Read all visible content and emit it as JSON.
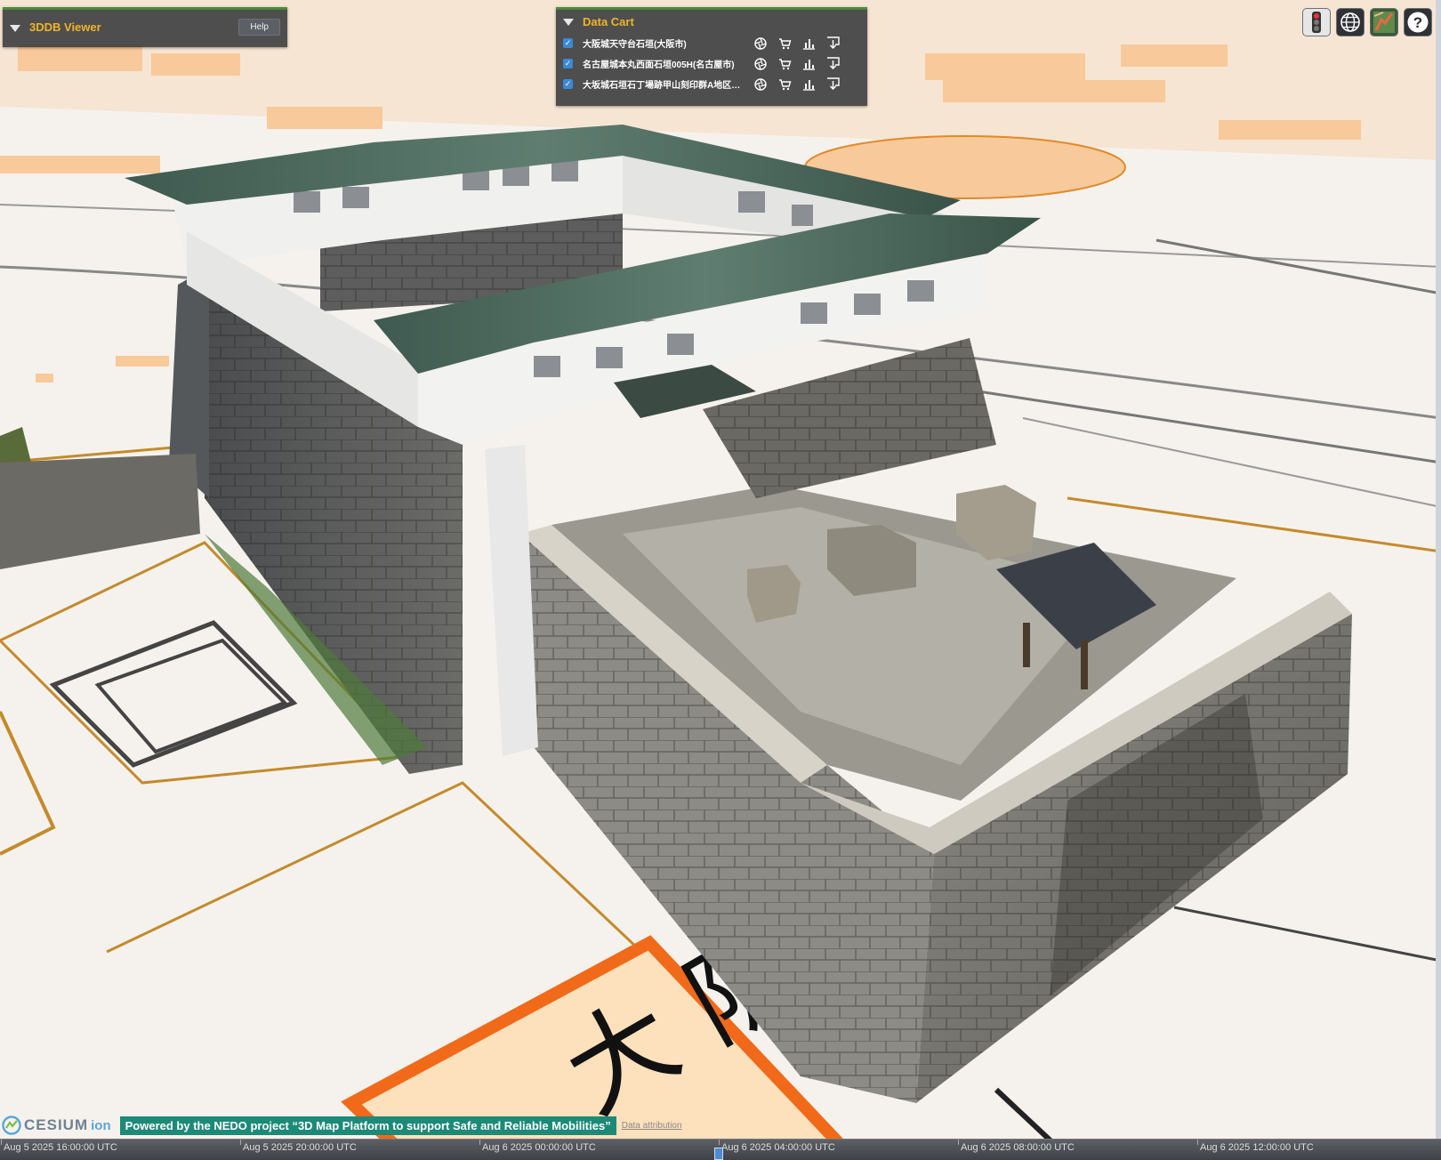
{
  "viewer_panel": {
    "title": "3DDB Viewer",
    "help_label": "Help"
  },
  "data_cart": {
    "title": "Data Cart",
    "items": [
      {
        "checked": true,
        "label": "大阪城天守台石垣(大阪市)"
      },
      {
        "checked": true,
        "label": "名古屋城本丸西面石垣005H(名古屋市)"
      },
      {
        "checked": true,
        "label": "大坂城石垣石丁場跡甲山刻印群A地区…"
      }
    ],
    "item_icons": [
      "aperture-icon",
      "cart-icon",
      "chart-icon",
      "download-icon"
    ]
  },
  "toolbar": {
    "buttons": [
      "traffic-light-icon",
      "globe-icon",
      "map-layer-icon",
      "help-icon"
    ],
    "help_glyph": "?"
  },
  "map": {
    "kanji_label": "大 阪"
  },
  "credits": {
    "cesium_logo": "CESIUM",
    "cesium_ion": "ion",
    "nedo": "Powered by the NEDO project “3D Map Platform to support Safe and Reliable Mobilities”",
    "attribution": "Data attribution"
  },
  "timeline": {
    "ticks": [
      "Aug 5 2025 16:00:00 UTC",
      "Aug 5 2025 20:00:00 UTC",
      "Aug 6 2025 00:00:00 UTC",
      "Aug 6 2025 04:00:00 UTC",
      "Aug 6 2025 08:00:00 UTC",
      "Aug 6 2025 12:00:00 UTC"
    ]
  },
  "colors": {
    "panel_accent": "#4a8a3c",
    "title_color": "#f0b428",
    "map_orange": "#f8c99a",
    "map_road": "#e08a2a",
    "nedo_bg": "#1d8a78"
  }
}
